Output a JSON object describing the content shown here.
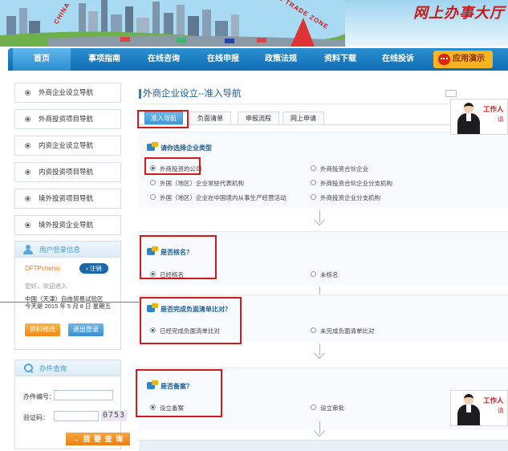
{
  "banner": {
    "title": "网上办事大厅",
    "stamp_left": "CHINA",
    "stamp_right": "FREE TRADE ZONE"
  },
  "nav": {
    "items": [
      "首页",
      "事项指南",
      "在线咨询",
      "在线申报",
      "政策法规",
      "资料下载",
      "在线投诉"
    ],
    "demo_label": "应用演示"
  },
  "sidebar": {
    "items": [
      "外商企业设立导航",
      "外商投资项目导航",
      "内资企业设立导航",
      "内资投资项目导航",
      "境外投资项目导航",
      "境外投资企业导航"
    ],
    "login": {
      "title": "用户登录信息",
      "username": "DFTPchensi",
      "logout": "注销",
      "welcome": "您好，欢迎进入",
      "org": "中国（天津）自由贸易试验区",
      "today": "今天是 2015 年 5 月 8 日 星期五",
      "modify": "资料修改",
      "exit": "退出登录"
    },
    "query": {
      "title": "办件查询",
      "number_label": "办件编号：",
      "code_label": "验证码：",
      "captcha": "0753",
      "search_button": "→ 我 要 查 询"
    }
  },
  "main": {
    "title": "外商企业设立--准入导航",
    "tabs": [
      "准入导航",
      "负面清单",
      "申报流程",
      "网上申请"
    ],
    "q1": {
      "title": "请你选择企业类型",
      "options": [
        "外商投资的公司",
        "外商投资合伙企业",
        "外国（地区）企业常驻代表机构",
        "外商投资合伙企业分支机构",
        "外国（地区）企业在中国境内从事生产经营活动",
        "外商投资企业分支机构"
      ]
    },
    "q2": {
      "title": "是否核名？",
      "yes": "已经核名",
      "no": "未核名"
    },
    "q3": {
      "title": "是否完成负面清单比对？",
      "yes": "已经完成负面清单比对",
      "no": "未完成负面清单比对"
    },
    "q4": {
      "title": "是否备案？",
      "yes": "设立备案",
      "no": "设立审批"
    },
    "agent": {
      "text": "工作人",
      "sub": "请"
    }
  },
  "colors": {
    "nav_blue": "#0f6db3",
    "highlight_red": "#d11a1a",
    "accent_orange": "#ef8a12"
  }
}
